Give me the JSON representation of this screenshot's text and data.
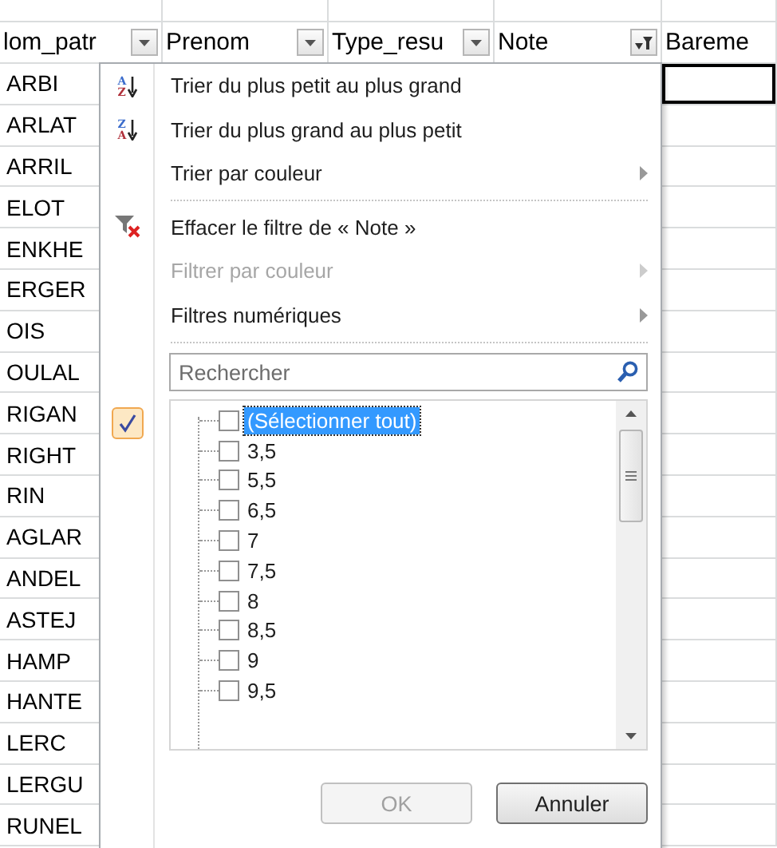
{
  "sheet": {
    "columns": [
      {
        "label": "lom_patr",
        "kind": "dropdown"
      },
      {
        "label": "Prenom",
        "kind": "dropdown"
      },
      {
        "label": "Type_resu",
        "kind": "dropdown"
      },
      {
        "label": "Note",
        "kind": "filtered"
      },
      {
        "label": "Bareme",
        "kind": "plain"
      }
    ],
    "rows": [
      {
        "column_1": "ARBI",
        "selected": true
      },
      {
        "column_1": "ARLAT",
        "selected": false
      },
      {
        "column_1": "ARRIL",
        "selected": false
      },
      {
        "column_1": "ELOT",
        "selected": false
      },
      {
        "column_1": "ENKHE",
        "selected": false
      },
      {
        "column_1": "ERGER",
        "selected": false
      },
      {
        "column_1": "OIS",
        "selected": false
      },
      {
        "column_1": "OULAL",
        "selected": false
      },
      {
        "column_1": "RIGAN",
        "selected": false
      },
      {
        "column_1": "RIGHT",
        "selected": false
      },
      {
        "column_1": "RIN",
        "selected": false
      },
      {
        "column_1": "AGLAR",
        "selected": false
      },
      {
        "column_1": "ANDEL",
        "selected": false
      },
      {
        "column_1": "ASTEJ",
        "selected": false
      },
      {
        "column_1": "HAMP",
        "selected": false
      },
      {
        "column_1": "HANTE",
        "selected": false
      },
      {
        "column_1": "LERC",
        "selected": false
      },
      {
        "column_1": "LERGU",
        "selected": false
      },
      {
        "column_1": "RUNEL",
        "selected": false
      }
    ]
  },
  "filter_menu": {
    "items": [
      {
        "label": "Trier du plus petit au plus grand",
        "kind": "sort",
        "icon_top": "A",
        "icon_bottom": "Z",
        "disabled": false,
        "submenu": false,
        "separator_after": false
      },
      {
        "label": "Trier du plus grand au plus petit",
        "kind": "sort",
        "icon_top": "Z",
        "icon_bottom": "A",
        "disabled": false,
        "submenu": false,
        "separator_after": false
      },
      {
        "label": "Trier par couleur",
        "kind": "plain",
        "disabled": false,
        "submenu": true,
        "separator_after": true
      },
      {
        "label": "Effacer le filtre de « Note »",
        "kind": "clear",
        "disabled": false,
        "submenu": false,
        "separator_after": false
      },
      {
        "label": "Filtrer par couleur",
        "kind": "plain",
        "disabled": true,
        "submenu": true,
        "separator_after": false
      },
      {
        "label": "Filtres numériques",
        "kind": "plain",
        "disabled": false,
        "submenu": true,
        "separator_after": true
      }
    ],
    "value_filter": {
      "checked": true
    },
    "search": {
      "placeholder": "Rechercher"
    },
    "values": [
      {
        "label": "(Sélectionner tout)",
        "checked": false,
        "selected": true
      },
      {
        "label": "3,5",
        "checked": false,
        "selected": false
      },
      {
        "label": "5,5",
        "checked": false,
        "selected": false
      },
      {
        "label": "6,5",
        "checked": false,
        "selected": false
      },
      {
        "label": "7",
        "checked": false,
        "selected": false
      },
      {
        "label": "7,5",
        "checked": false,
        "selected": false
      },
      {
        "label": "8",
        "checked": false,
        "selected": false
      },
      {
        "label": "8,5",
        "checked": false,
        "selected": false
      },
      {
        "label": "9",
        "checked": false,
        "selected": false
      },
      {
        "label": "9,5",
        "checked": false,
        "selected": false
      }
    ],
    "buttons": [
      {
        "label": "OK",
        "disabled": true
      },
      {
        "label": "Annuler",
        "disabled": false
      }
    ]
  }
}
